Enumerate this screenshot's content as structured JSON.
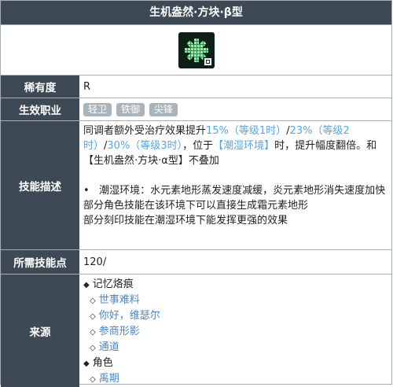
{
  "title": "生机盎然·方块·β型",
  "rarity": {
    "label": "稀有度",
    "value": "R"
  },
  "classes": {
    "label": "生效职业",
    "tags": [
      "轻卫",
      "铁御",
      "尖锋"
    ]
  },
  "desc": {
    "label": "技能描述",
    "p1_a": "同调者额外受治疗效果提升",
    "p1_v1": "15%（等级1时）",
    "p1_s1": "/",
    "p1_v2": "23%（等级2时）",
    "p1_s2": "/",
    "p1_v3": "30%（等级3时）",
    "p1_b": "，位于",
    "p1_env": "【潮湿环境】",
    "p1_c": "时，提升幅度翻倍。和【生机盎然·方块·α型】不叠加",
    "bullet": "•",
    "p2": "潮湿环境：水元素地形蒸发速度减缓，炎元素地形消失速度加快",
    "p3": "部分角色技能在该环境下可以直接生成霜元素地形",
    "p4": "部分刻印技能在潮湿环境下能发挥更强的效果"
  },
  "points": {
    "label": "所需技能点",
    "value": "120/"
  },
  "source": {
    "label": "来源",
    "g1": "记忆烙痕",
    "g1_items": [
      "世事难料",
      "你好，维瑟尔",
      "参商形影",
      "通道"
    ],
    "g2": "角色",
    "g2_items": [
      "禹期"
    ],
    "diamond_filled": "◆",
    "diamond_open": "◇"
  },
  "icon": "green-pixel-asterisk-icon"
}
